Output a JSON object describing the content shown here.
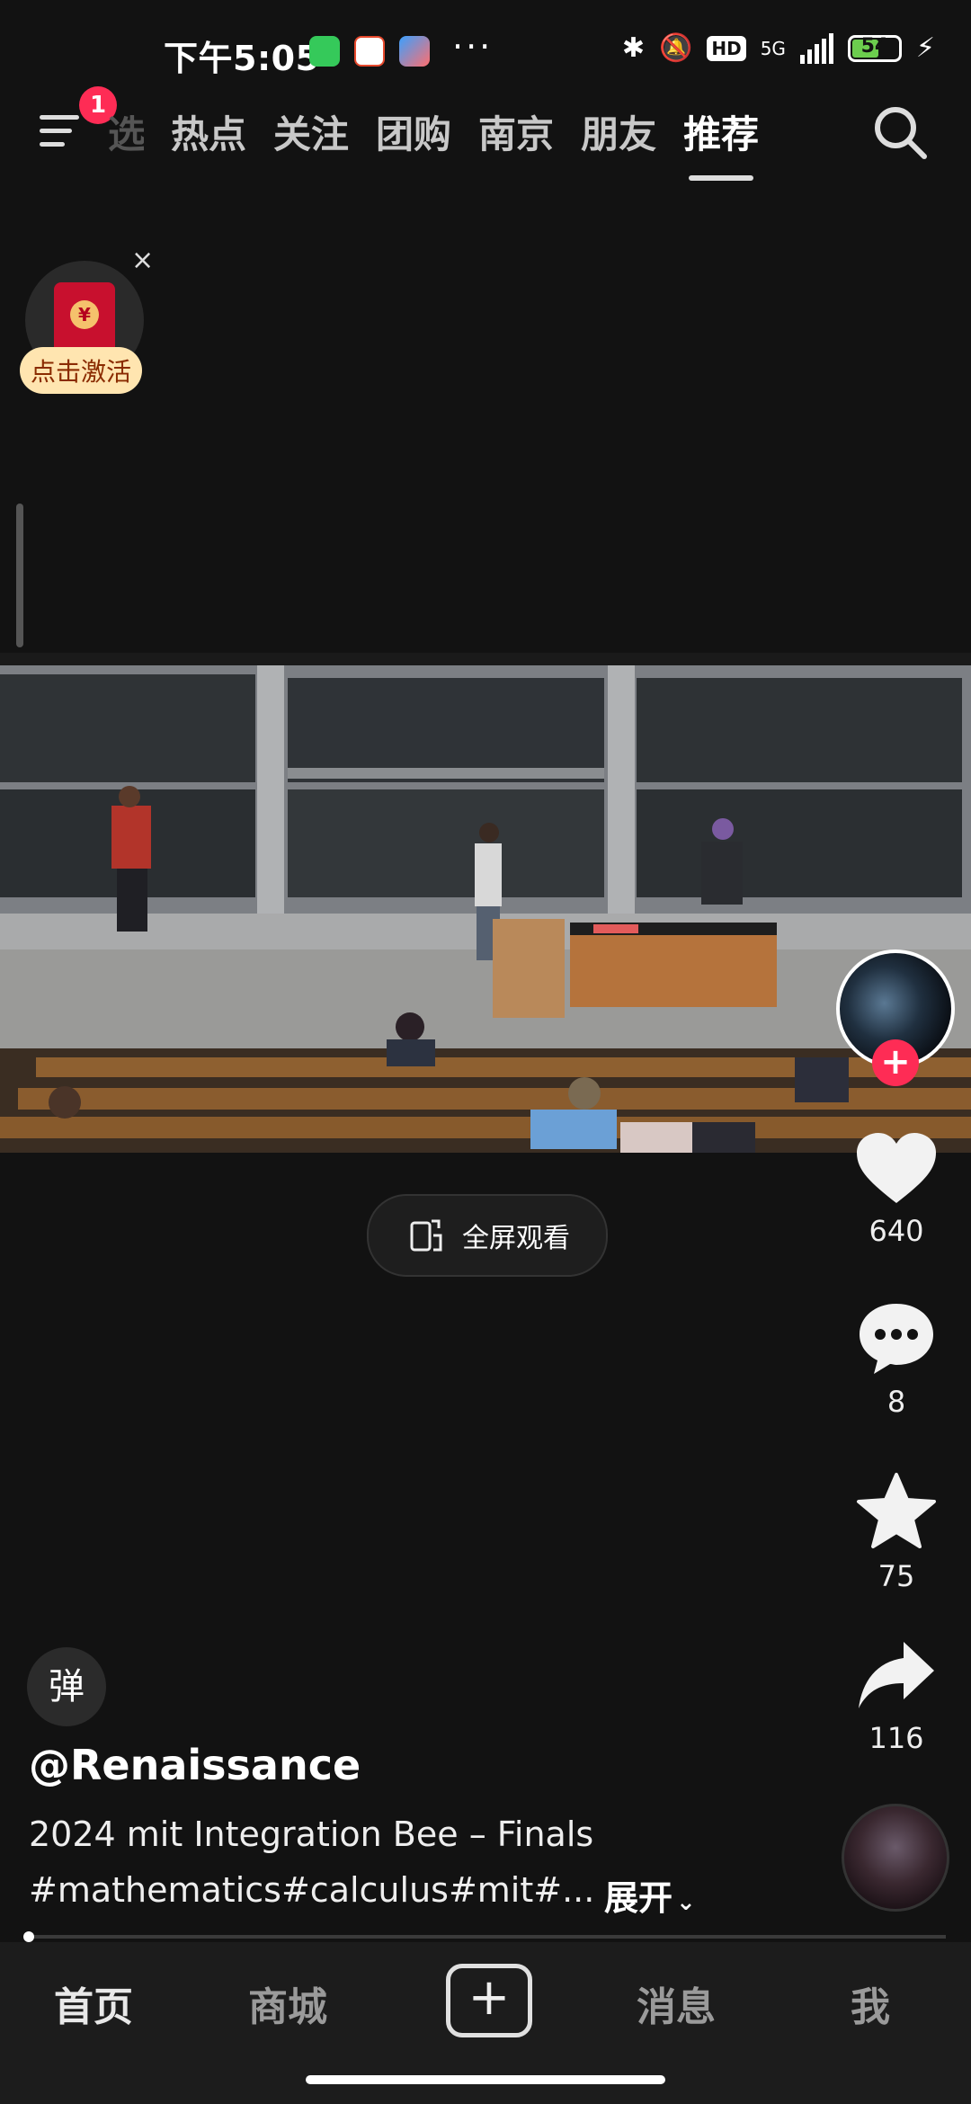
{
  "status_bar": {
    "time": "下午5:05",
    "battery": "54",
    "network": "5G",
    "hd": "HD",
    "more": "···"
  },
  "top_nav": {
    "menu_badge": "1",
    "tabs": [
      "选",
      "热点",
      "关注",
      "团购",
      "南京",
      "朋友",
      "推荐"
    ],
    "active_tab": "推荐"
  },
  "red_packet": {
    "label": "点击激活",
    "close": "×",
    "coin": "¥"
  },
  "video": {
    "fullscreen_label": "全屏观看"
  },
  "actions": {
    "likes": "640",
    "comments": "8",
    "favorites": "75",
    "shares": "116",
    "follow": "+"
  },
  "info": {
    "danmu": "弹",
    "author": "@Renaissance",
    "title": "2024 mit Integration Bee – Finals",
    "tags": "#mathematics#calculus#mit#...",
    "expand": "展开"
  },
  "bottom_nav": {
    "items": [
      "首页",
      "商城",
      "消息",
      "我"
    ],
    "add": "+",
    "active": "首页"
  },
  "colors": {
    "background": "#121212",
    "accent": "#fe2c55",
    "battery": "#6ccd4e"
  }
}
